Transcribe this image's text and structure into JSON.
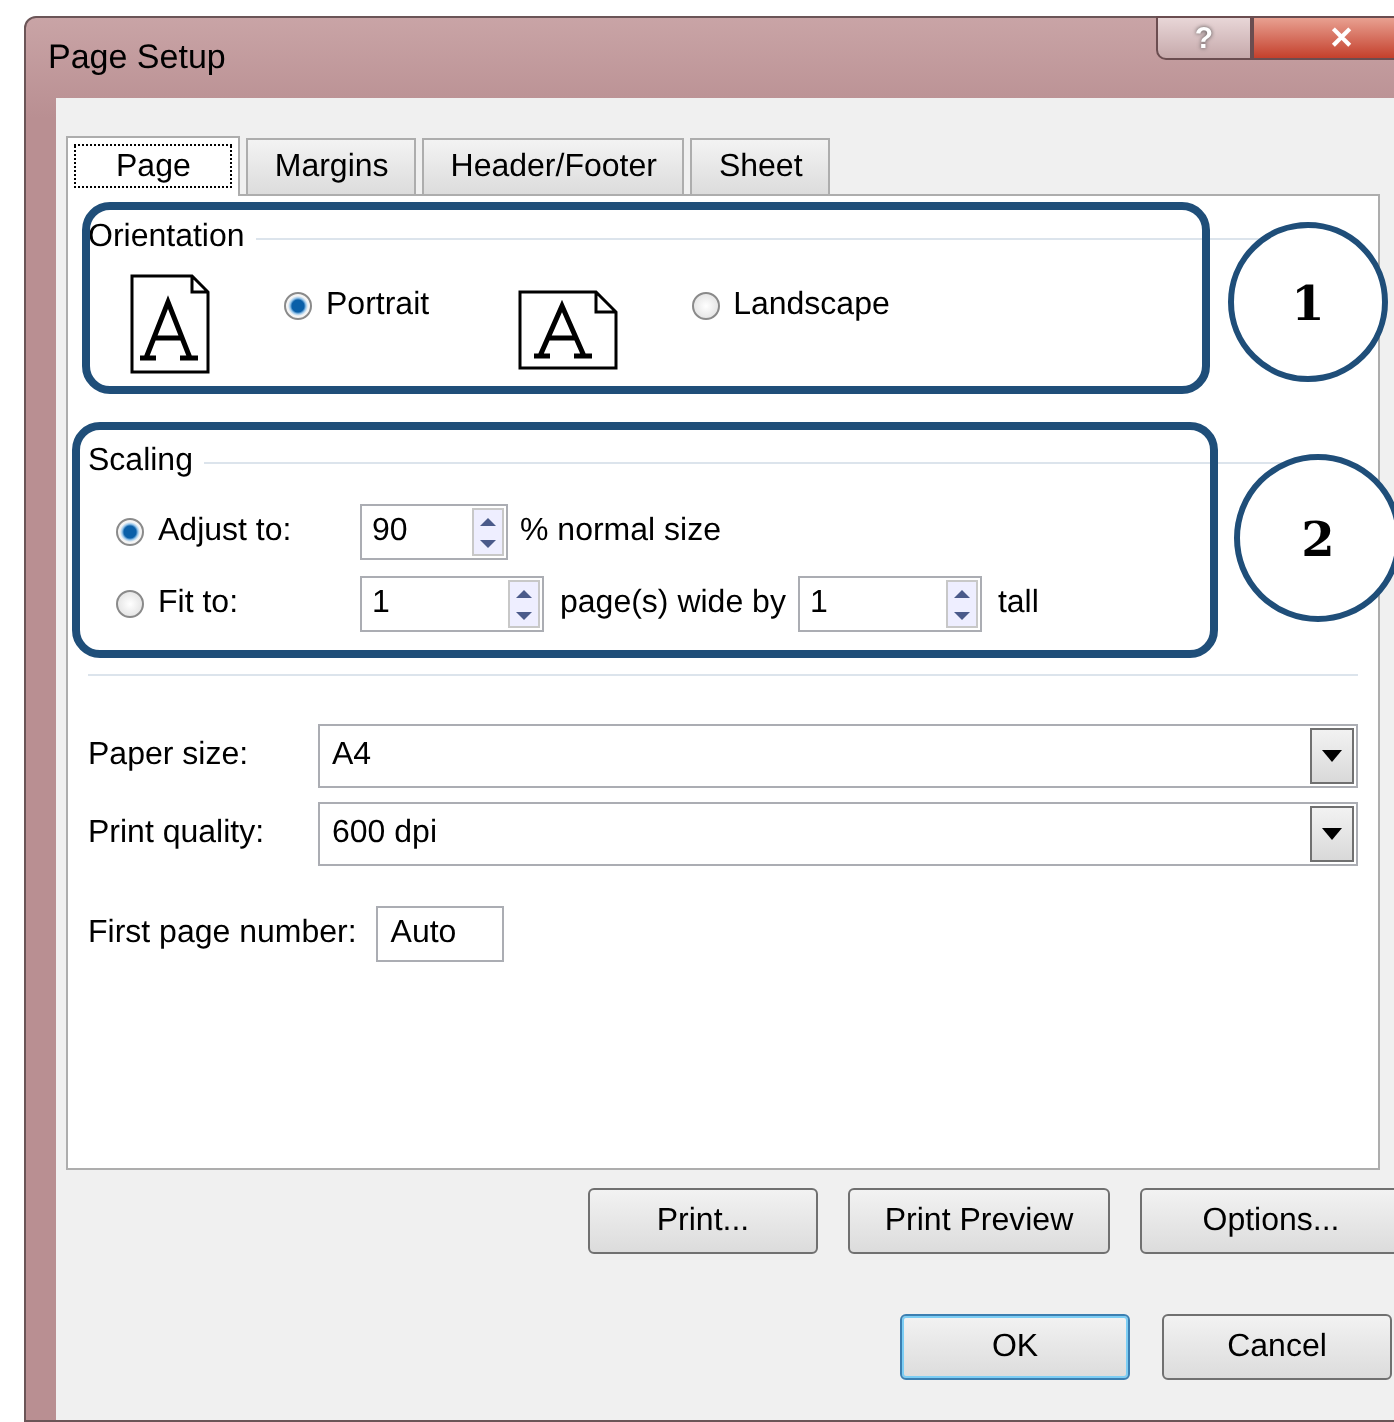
{
  "window": {
    "title": "Page Setup",
    "help_button": "?",
    "close_button": "✕"
  },
  "tabs": [
    {
      "label": "Page",
      "selected": true
    },
    {
      "label": "Margins",
      "selected": false
    },
    {
      "label": "Header/Footer",
      "selected": false
    },
    {
      "label": "Sheet",
      "selected": false
    }
  ],
  "orientation": {
    "legend": "Orientation",
    "options": [
      {
        "kind": "portrait",
        "label": "Portrait",
        "selected": true
      },
      {
        "kind": "landscape",
        "label": "Landscape",
        "selected": false
      }
    ]
  },
  "scaling": {
    "legend": "Scaling",
    "adjust": {
      "label": "Adjust to:",
      "selected": true,
      "value": "90",
      "suffix": "% normal size"
    },
    "fit": {
      "label": "Fit to:",
      "selected": false,
      "wide_value": "1",
      "wide_suffix": "page(s) wide by",
      "tall_value": "1",
      "tall_suffix": "tall"
    }
  },
  "paper_size": {
    "label": "Paper size:",
    "value": "A4"
  },
  "print_quality": {
    "label": "Print quality:",
    "value": "600 dpi"
  },
  "first_page_number": {
    "label": "First page number:",
    "value": "Auto"
  },
  "action_buttons": [
    "Print...",
    "Print Preview",
    "Options..."
  ],
  "dialog_buttons": [
    {
      "label": "OK",
      "default": true
    },
    {
      "label": "Cancel",
      "default": false
    }
  ],
  "annotations": [
    "1",
    "2"
  ]
}
